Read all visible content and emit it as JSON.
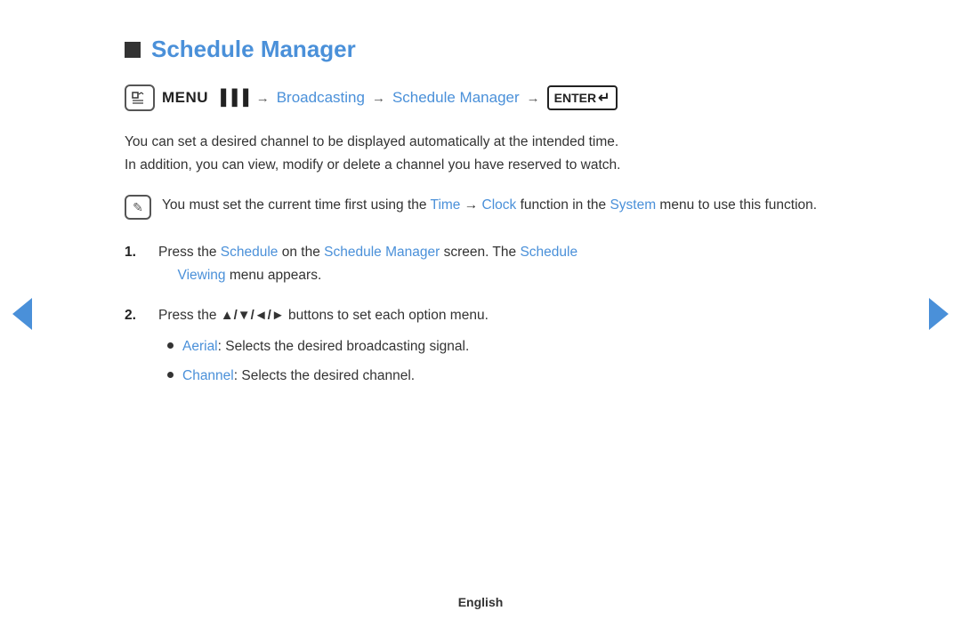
{
  "page": {
    "title": "Schedule Manager",
    "title_square_label": "square-icon",
    "breadcrumb": {
      "menu_icon_label": "MENU",
      "menu_bold": "MENU",
      "arrow1": "→",
      "broadcasting": "Broadcasting",
      "arrow2": "→",
      "schedule_manager": "Schedule Manager",
      "arrow3": "→",
      "enter_label": "ENTER"
    },
    "description": "You can set a desired channel to be displayed automatically at the intended time.\nIn addition, you can view, modify or delete a channel you have reserved to watch.",
    "note": {
      "icon_label": "✎",
      "text_before": "You must set the current time first using the ",
      "time_link": "Time",
      "arrow": "→",
      "clock_link": "Clock",
      "text_middle": " function in the ",
      "system_link": "System",
      "text_after": " menu to use this function."
    },
    "steps": [
      {
        "number": "1.",
        "text_before": "Press the ",
        "schedule_link": "Schedule",
        "text_middle": " on the ",
        "schedule_manager_link": "Schedule Manager",
        "text_after": " screen. The ",
        "schedule_viewing_link": "Schedule\nViewing",
        "text_end": " menu appears."
      },
      {
        "number": "2.",
        "text": "Press the ▲/▼/◄/► buttons to set each option menu."
      }
    ],
    "bullets": [
      {
        "label": "Aerial",
        "text": ": Selects the desired broadcasting signal."
      },
      {
        "label": "Channel",
        "text": ": Selects the desired channel."
      }
    ],
    "nav_left": "◄",
    "nav_right": "►",
    "footer": "English"
  }
}
